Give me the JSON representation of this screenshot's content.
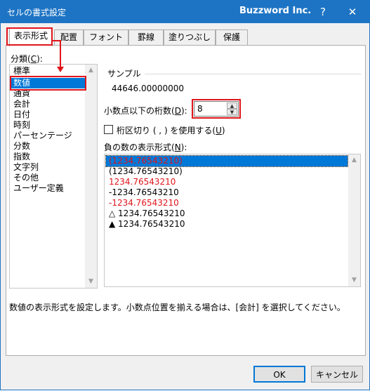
{
  "window": {
    "title": "セルの書式設定",
    "brand": "Buzzword Inc.",
    "help": "?",
    "close": "✕"
  },
  "tabs": [
    {
      "label": "表示形式",
      "active": true
    },
    {
      "label": "配置"
    },
    {
      "label": "フォント"
    },
    {
      "label": "罫線"
    },
    {
      "label": "塗りつぶし"
    },
    {
      "label": "保護"
    }
  ],
  "category": {
    "label": "分類(",
    "accel": "C",
    "label_end": "):",
    "items": [
      "標準",
      "数値",
      "通貨",
      "会計",
      "日付",
      "時刻",
      "パーセンテージ",
      "分数",
      "指数",
      "文字列",
      "その他",
      "ユーザー定義"
    ],
    "selected_index": 1
  },
  "sample": {
    "label": "サンプル",
    "value": "44646.00000000"
  },
  "decimal": {
    "label": "小数点以下の桁数(",
    "accel": "D",
    "label_end": "):",
    "value": "8"
  },
  "separator": {
    "label": "桁区切り ( , ) を使用する(",
    "accel": "U",
    "label_end": ")",
    "checked": false
  },
  "negative": {
    "label": "負の数の表示形式(",
    "accel": "N",
    "label_end": "):",
    "items": [
      {
        "text": "(1234.76543210)",
        "red": true,
        "selected": true
      },
      {
        "text": "(1234.76543210)",
        "red": false
      },
      {
        "text": "1234.76543210",
        "red": true
      },
      {
        "text": "-1234.76543210",
        "red": false
      },
      {
        "text": "-1234.76543210",
        "red": true
      },
      {
        "text": "△ 1234.76543210",
        "red": false
      },
      {
        "text": "▲ 1234.76543210",
        "red": false
      }
    ]
  },
  "description": "数値の表示形式を設定します。小数点位置を揃える場合は、[会計] を選択してください。",
  "buttons": {
    "ok": "OK",
    "cancel": "キャンセル"
  },
  "colors": {
    "titlebar": "#1e74c4",
    "selection": "#0078d7",
    "annotation_red": "#e0151b",
    "negative_red": "#e0151b"
  }
}
